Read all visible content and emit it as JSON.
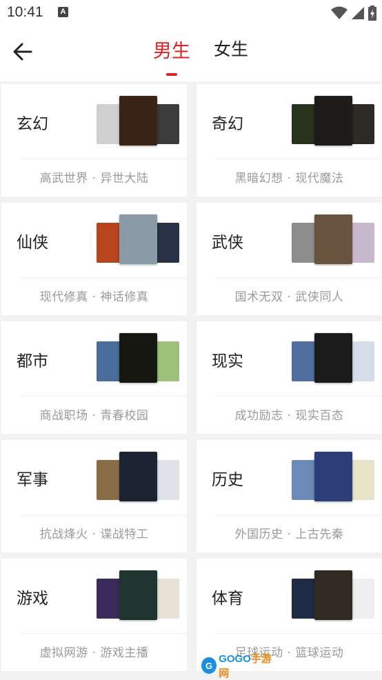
{
  "status_bar": {
    "time": "10:41",
    "notification_icon": "A"
  },
  "header": {
    "tabs": [
      {
        "label": "男生",
        "active": true
      },
      {
        "label": "女生",
        "active": false
      }
    ]
  },
  "colors": {
    "accent": "#e02121",
    "subtitle": "#9a9a9a",
    "background": "#f2f2f2"
  },
  "categories": [
    {
      "title": "玄幻",
      "subtitle": "高武世界 · 异世大陆",
      "covers": [
        "#cfcfcf",
        "#3a2415",
        "#3b3b3b"
      ]
    },
    {
      "title": "奇幻",
      "subtitle": "黑暗幻想 · 现代魔法",
      "covers": [
        "#27321f",
        "#1e1c1a",
        "#2d2a25"
      ]
    },
    {
      "title": "仙侠",
      "subtitle": "现代修真 · 神话修真",
      "covers": [
        "#b8441d",
        "#8a9aa6",
        "#2a3247"
      ]
    },
    {
      "title": "武侠",
      "subtitle": "国术无双 · 武侠同人",
      "covers": [
        "#8d8d8d",
        "#6a5440",
        "#c9b9cf"
      ]
    },
    {
      "title": "都市",
      "subtitle": "商战职场 · 青春校园",
      "covers": [
        "#4a6c9b",
        "#181812",
        "#9ac07a"
      ]
    },
    {
      "title": "现实",
      "subtitle": "成功励志 · 现实百态",
      "covers": [
        "#4f6fa1",
        "#1b1b1b",
        "#d4dde9"
      ]
    },
    {
      "title": "军事",
      "subtitle": "抗战烽火 · 谍战特工",
      "covers": [
        "#8a6d45",
        "#1c2433",
        "#dfe3e8"
      ]
    },
    {
      "title": "历史",
      "subtitle": "外国历史 · 上古先秦",
      "covers": [
        "#6b8ab7",
        "#2c3e78",
        "#e8e2c8"
      ]
    },
    {
      "title": "游戏",
      "subtitle": "虚拟网游 · 游戏主播",
      "covers": [
        "#3b2a5c",
        "#1e3530",
        "#e7e1d6"
      ]
    },
    {
      "title": "体育",
      "subtitle": "足球运动 · 篮球运动",
      "covers": [
        "#1f2a44",
        "#2f2a22",
        "#eeeeee"
      ]
    }
  ],
  "watermark": {
    "logo": "G",
    "brand": "GOGO",
    "zh": "手游网"
  }
}
